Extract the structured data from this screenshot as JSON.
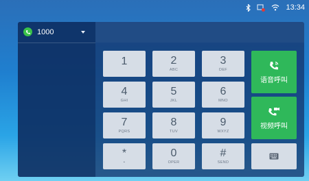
{
  "status_bar": {
    "time": "13:34",
    "icons": [
      "bluetooth-icon",
      "notification-icon",
      "wifi-icon"
    ]
  },
  "account": {
    "number": "1000",
    "status_color": "#39c24a"
  },
  "keypad": [
    {
      "digit": "1",
      "letters": ""
    },
    {
      "digit": "2",
      "letters": "ABC"
    },
    {
      "digit": "3",
      "letters": "DEF"
    },
    {
      "digit": "4",
      "letters": "GHI"
    },
    {
      "digit": "5",
      "letters": "JKL"
    },
    {
      "digit": "6",
      "letters": "MNO"
    },
    {
      "digit": "7",
      "letters": "PQRS"
    },
    {
      "digit": "8",
      "letters": "TUV"
    },
    {
      "digit": "9",
      "letters": "WXYZ"
    },
    {
      "digit": "*",
      "letters": "•"
    },
    {
      "digit": "0",
      "letters": "OPER"
    },
    {
      "digit": "#",
      "letters": "SEND"
    }
  ],
  "actions": {
    "voice_call": "语音呼叫",
    "video_call": "视频呼叫",
    "accent": "#2fb85a"
  }
}
